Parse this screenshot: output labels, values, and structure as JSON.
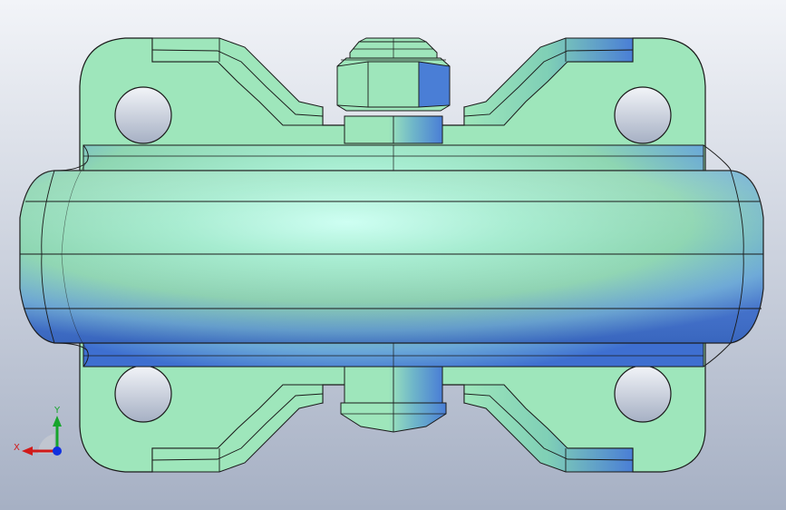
{
  "viewport": {
    "background_top": "#f2f4f8",
    "background_bottom": "#a6b0c4"
  },
  "model": {
    "base_color": "#9ee6bb",
    "highlight_color": "#c8fff0",
    "shade_color": "#4a7ed6",
    "edge_color": "#1a1a1a"
  },
  "triad": {
    "x_label": "X",
    "y_label": "Y",
    "x_color": "#d11a1a",
    "y_color": "#16a52c",
    "z_color": "#1030e0"
  }
}
